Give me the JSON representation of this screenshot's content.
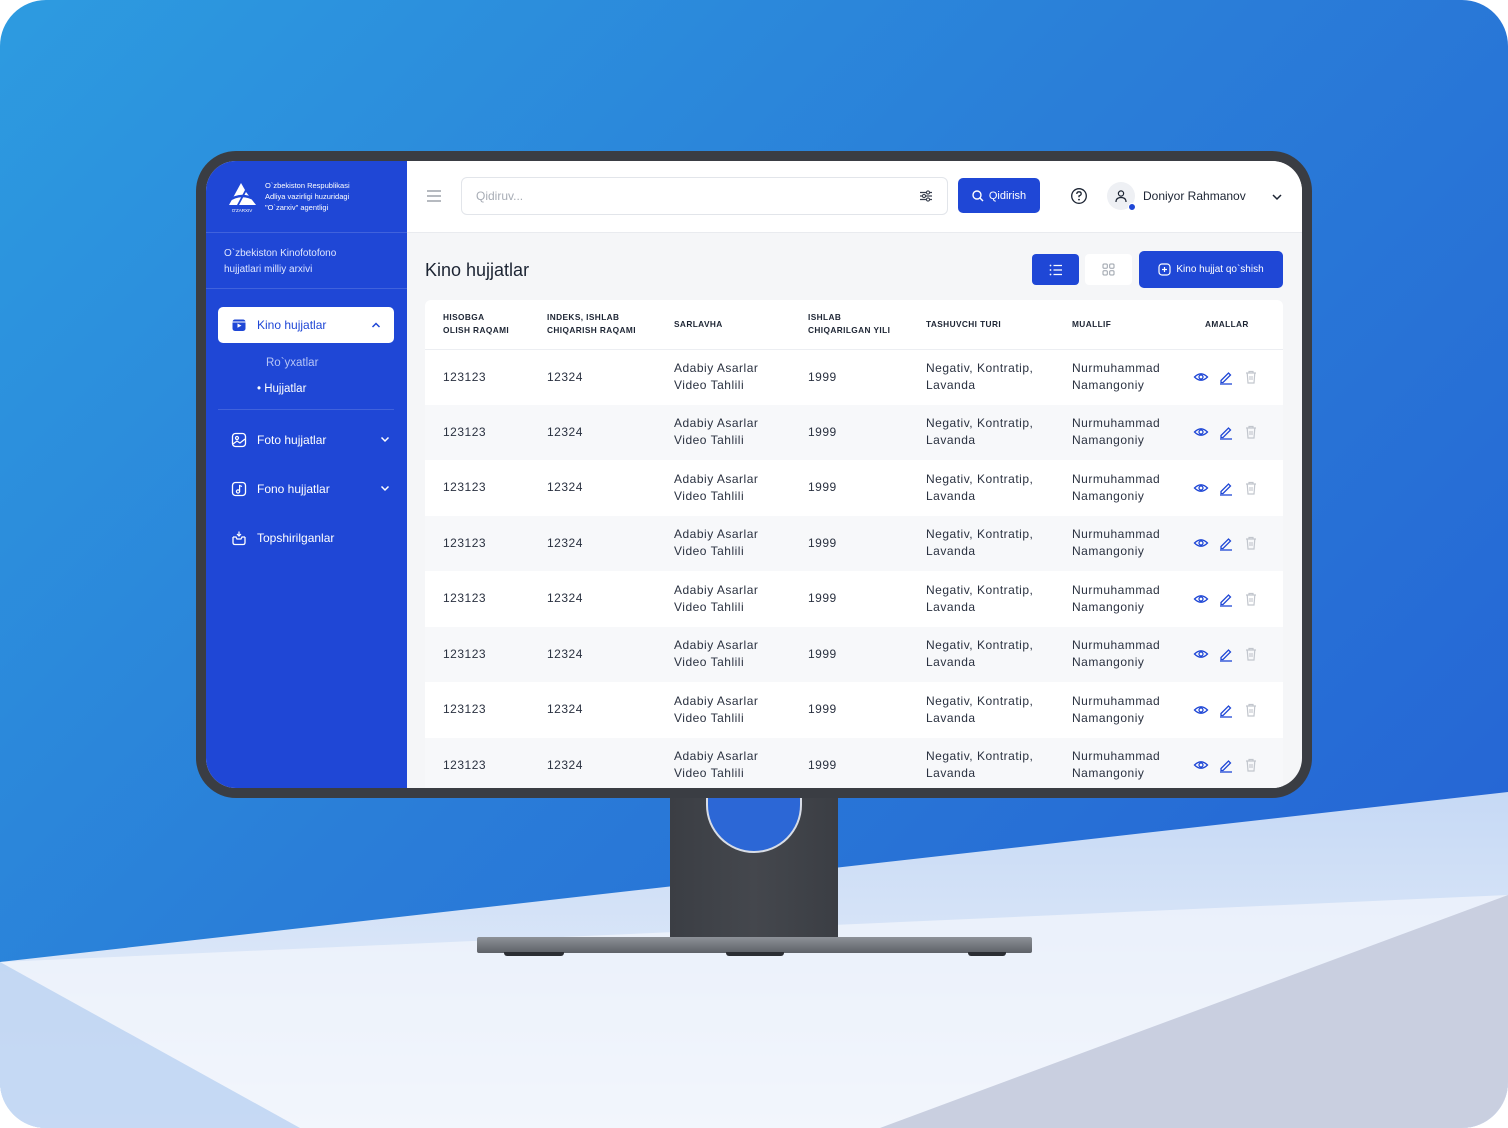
{
  "brand": {
    "logo_text": "O'ZARXIV",
    "org_line1": "O`zbekiston Respublikasi",
    "org_line2": "Adliya vazirligi huzuridagi",
    "org_line3": "\"O`zarxiv\" agentligi"
  },
  "sidebar": {
    "archive_line1": "O`zbekiston Kinofotofono",
    "archive_line2": "hujjatlari milliy arxivi",
    "active_item": "Kino hujjatlar",
    "sub_items": [
      "Ro`yxatlar",
      "• Hujjatlar"
    ],
    "items": [
      "Foto hujjatlar",
      "Fono hujjatlar",
      "Topshirilganlar"
    ]
  },
  "topbar": {
    "search_placeholder": "Qidiruv...",
    "search_button": "Qidirish",
    "user_name": "Doniyor Rahmanov"
  },
  "page": {
    "title": "Kino hujjatlar",
    "add_button": "Kino hujjat qo`shish"
  },
  "table": {
    "columns": [
      {
        "line1": "HISOBGA",
        "line2": "OLISH RAQAMI"
      },
      {
        "line1": "INDEKS, ISHLAB",
        "line2": "CHIQARISH RAQAMI"
      },
      {
        "line1": "SARLAVHA",
        "line2": ""
      },
      {
        "line1": "ISHLAB",
        "line2": "CHIQARILGAN YILI"
      },
      {
        "line1": "TASHUVCHI TURI",
        "line2": ""
      },
      {
        "line1": "MUALLIF",
        "line2": ""
      },
      {
        "line1": "AMALLAR",
        "line2": ""
      }
    ],
    "rows": [
      {
        "hisob": "123123",
        "indeks": "12324",
        "sarlavha1": "Adabiy Asarlar",
        "sarlavha2": "Video Tahlili",
        "yil": "1999",
        "tur1": "Negativ, Kontratip,",
        "tur2": "Lavanda",
        "muallif1": "Nurmuhammad",
        "muallif2": "Namangoniy"
      },
      {
        "hisob": "123123",
        "indeks": "12324",
        "sarlavha1": "Adabiy Asarlar",
        "sarlavha2": "Video Tahlili",
        "yil": "1999",
        "tur1": "Negativ, Kontratip,",
        "tur2": "Lavanda",
        "muallif1": "Nurmuhammad",
        "muallif2": "Namangoniy"
      },
      {
        "hisob": "123123",
        "indeks": "12324",
        "sarlavha1": "Adabiy Asarlar",
        "sarlavha2": "Video Tahlili",
        "yil": "1999",
        "tur1": "Negativ, Kontratip,",
        "tur2": "Lavanda",
        "muallif1": "Nurmuhammad",
        "muallif2": "Namangoniy"
      },
      {
        "hisob": "123123",
        "indeks": "12324",
        "sarlavha1": "Adabiy Asarlar",
        "sarlavha2": "Video Tahlili",
        "yil": "1999",
        "tur1": "Negativ, Kontratip,",
        "tur2": "Lavanda",
        "muallif1": "Nurmuhammad",
        "muallif2": "Namangoniy"
      },
      {
        "hisob": "123123",
        "indeks": "12324",
        "sarlavha1": "Adabiy Asarlar",
        "sarlavha2": "Video Tahlili",
        "yil": "1999",
        "tur1": "Negativ, Kontratip,",
        "tur2": "Lavanda",
        "muallif1": "Nurmuhammad",
        "muallif2": "Namangoniy"
      },
      {
        "hisob": "123123",
        "indeks": "12324",
        "sarlavha1": "Adabiy Asarlar",
        "sarlavha2": "Video Tahlili",
        "yil": "1999",
        "tur1": "Negativ, Kontratip,",
        "tur2": "Lavanda",
        "muallif1": "Nurmuhammad",
        "muallif2": "Namangoniy"
      },
      {
        "hisob": "123123",
        "indeks": "12324",
        "sarlavha1": "Adabiy Asarlar",
        "sarlavha2": "Video Tahlili",
        "yil": "1999",
        "tur1": "Negativ, Kontratip,",
        "tur2": "Lavanda",
        "muallif1": "Nurmuhammad",
        "muallif2": "Namangoniy"
      },
      {
        "hisob": "123123",
        "indeks": "12324",
        "sarlavha1": "Adabiy Asarlar",
        "sarlavha2": "Video Tahlili",
        "yil": "1999",
        "tur1": "Negativ, Kontratip,",
        "tur2": "Lavanda",
        "muallif1": "Nurmuhammad",
        "muallif2": "Namangoniy"
      }
    ]
  },
  "icons": {
    "menu": "menu-icon",
    "filter": "filter-icon",
    "search": "search-icon",
    "help": "help-icon",
    "user": "user-icon",
    "chevron": "chevron-down-icon",
    "list": "list-view-icon",
    "grid": "grid-view-icon",
    "add": "add-icon",
    "view": "eye-icon",
    "edit": "pencil-icon",
    "delete": "trash-icon"
  },
  "colors": {
    "primary": "#1f47d6",
    "background_gradient_start": "#2d9be0",
    "monitor_bezel": "#3a3d43",
    "content_bg": "#f5f6f8"
  }
}
